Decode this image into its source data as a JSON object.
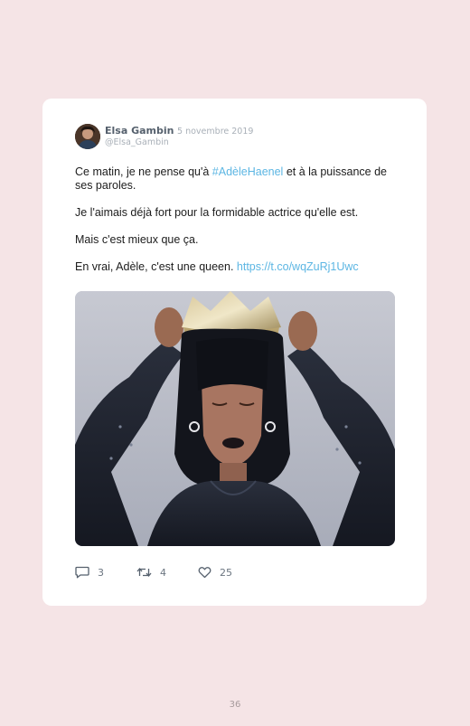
{
  "tweet": {
    "author": {
      "name": "Elsa Gambin",
      "date": "· 5 novembre 2019",
      "handle": "@Elsa_Gambin"
    },
    "paragraph_1": {
      "before": "Ce matin, je ne pense qu'à ",
      "hashtag": "#AdèleHaenel",
      "after": " et à la puissance de ses paroles."
    },
    "paragraph_2": "Je l'aimais déjà fort pour la formidable actrice qu'elle est.",
    "paragraph_3": "Mais c'est mieux que ça.",
    "paragraph_4": {
      "before": "En vrai, Adèle, c'est une queen. ",
      "link": "https://t.co/wqZuRj1Uwc"
    },
    "actions": {
      "replies": "3",
      "retweets": "4",
      "likes": "25"
    }
  },
  "icons": {
    "reply": "speech-bubble-icon",
    "retweet": "retweet-arrows-icon",
    "like": "heart-icon"
  },
  "colors": {
    "page_background": "#f5e4e6",
    "card_background": "#ffffff",
    "link": "#5cb6e3",
    "muted": "#a9b0b8"
  },
  "page_number": "36"
}
